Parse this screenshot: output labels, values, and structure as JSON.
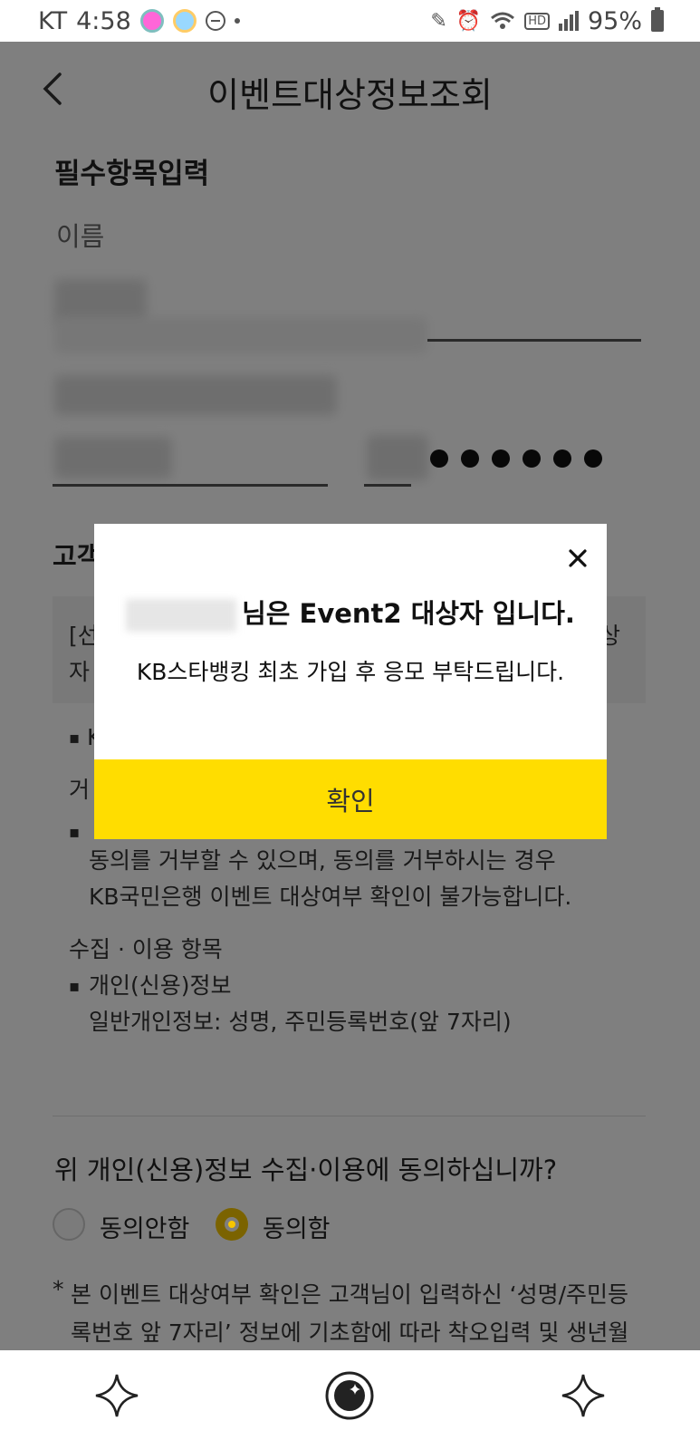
{
  "status_bar": {
    "carrier": "KT",
    "time": "4:58",
    "battery": "95%",
    "hd": "HD"
  },
  "header": {
    "title": "이벤트대상정보조회"
  },
  "form": {
    "section_title": "필수항목입력",
    "name_label": "이름"
  },
  "consent": {
    "section_title_partial": "고객",
    "notice_line1_start": "[선",
    "notice_line1_end": "상",
    "notice_line2_start": "자",
    "partial_bullet": "K",
    "refuse_heading_partial": "거",
    "refuse_line1": "동의를 거부할 수 있으며, 동의를 거부하시는 경우",
    "refuse_line2": "KB국민은행 이벤트 대상여부 확인이 불가능합니다.",
    "items_heading": "수집 · 이용 항목",
    "items_line1": "개인(신용)정보",
    "items_line2": "일반개인정보: 성명, 주민등록번호(앞 7자리)",
    "question": "위 개인(신용)정보 수집·이용에 동의하십니까?",
    "option_disagree": "동의안함",
    "option_agree": "동의함",
    "selected": "동의함",
    "footnote": "본 이벤트 대상여부 확인은 고객님이 입력하신 ‘성명/주민등록번호 앞 7자리’ 정보에 기초함에 따라 착오입력 및 생년월일/성별이 일치하는 동명이인 여부 등의 사유로 실제와 다른"
  },
  "modal": {
    "title_suffix": "님은 Event2 대상자 입니다.",
    "message": "KB스타뱅킹 최초 가입 후 응모 부탁드립니다.",
    "confirm_label": "확인",
    "icons": [
      "close-icon"
    ]
  },
  "bottom_bar": {
    "icons": [
      "sparkle-icon",
      "bixby-icon",
      "sparkle-icon"
    ]
  },
  "colors": {
    "accent_yellow": "#ffdd00",
    "radio_selected": "#f7c600",
    "dim_overlay": "rgba(0,0,0,0.5)"
  }
}
